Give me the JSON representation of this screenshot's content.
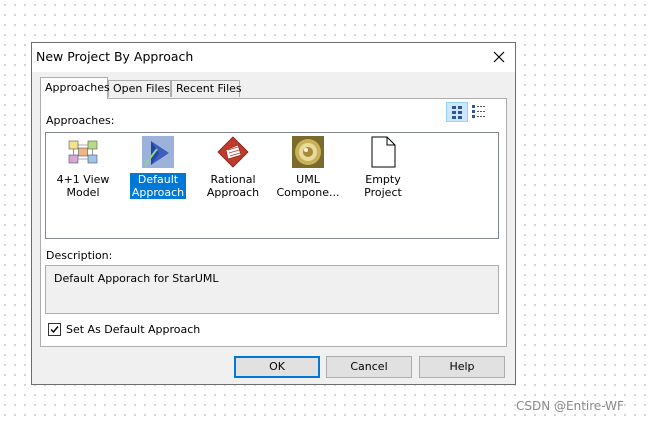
{
  "window": {
    "title": "New Project By Approach"
  },
  "tabs": [
    {
      "label": "Approaches",
      "active": true
    },
    {
      "label": "Open Files",
      "active": false
    },
    {
      "label": "Recent Files",
      "active": false
    }
  ],
  "view_toggles": [
    {
      "icon": "large-icons-view-icon",
      "active": true
    },
    {
      "icon": "list-view-icon",
      "active": false
    }
  ],
  "approaches_label": "Approaches:",
  "approaches": [
    {
      "label": "4+1 View\nModel",
      "icon": "four-plus-one-view-icon",
      "selected": false
    },
    {
      "label": "Default\nApproach",
      "icon": "default-approach-icon",
      "selected": true
    },
    {
      "label": "Rational\nApproach",
      "icon": "rational-approach-icon",
      "selected": false
    },
    {
      "label": "UML\nCompone...",
      "icon": "uml-components-icon",
      "selected": false
    },
    {
      "label": "Empty Project",
      "icon": "empty-project-icon",
      "selected": false
    }
  ],
  "description_label": "Description:",
  "description_text": "Default Apporach for StarUML",
  "default_checkbox": {
    "label": "Set As Default Approach",
    "checked": true
  },
  "buttons": {
    "ok": "OK",
    "cancel": "Cancel",
    "help": "Help"
  },
  "watermark": "CSDN @Entire-WF",
  "colors": {
    "selection": "#0078d7",
    "dialog_bg": "#f0f0f0",
    "default_button_border": "#0078d7"
  }
}
